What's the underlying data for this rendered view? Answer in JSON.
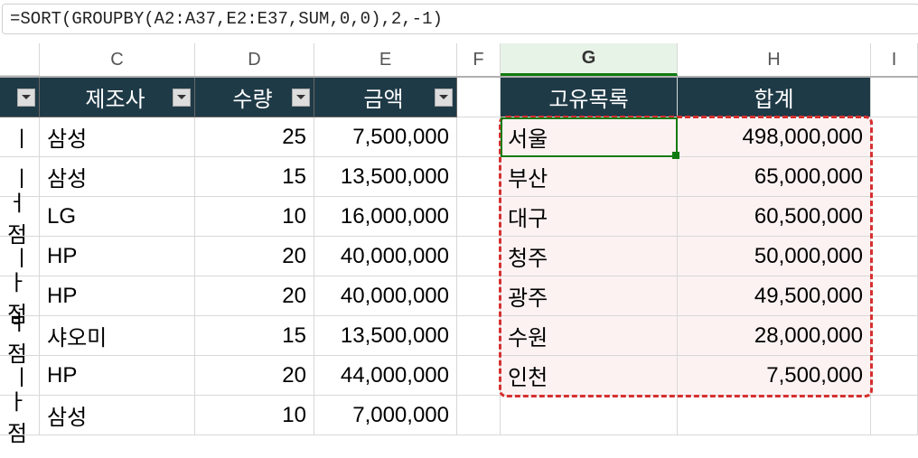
{
  "formula": "=SORT(GROUPBY(A2:A37,E2:E37,SUM,0,0),2,-1)",
  "col_headers": {
    "c": "C",
    "d": "D",
    "e": "E",
    "f": "F",
    "g": "G",
    "h": "H",
    "i": "I"
  },
  "table_headers": {
    "c": "제조사",
    "d": "수량",
    "e": "금액"
  },
  "summary_headers": {
    "g": "고유목록",
    "h": "합계"
  },
  "left_rows": [
    {
      "c": "삼성",
      "d": "25",
      "e": "7,500,000"
    },
    {
      "c": "삼성",
      "d": "15",
      "e": "13,500,000"
    },
    {
      "c": "LG",
      "d": "10",
      "e": "16,000,000"
    },
    {
      "c": "HP",
      "d": "20",
      "e": "40,000,000"
    },
    {
      "c": "HP",
      "d": "20",
      "e": "40,000,000"
    },
    {
      "c": "샤오미",
      "d": "15",
      "e": "13,500,000"
    },
    {
      "c": "HP",
      "d": "20",
      "e": "44,000,000"
    },
    {
      "c": "삼성",
      "d": "10",
      "e": "7,000,000"
    }
  ],
  "summary_rows": [
    {
      "g": "서울",
      "h": "498,000,000"
    },
    {
      "g": "부산",
      "h": "65,000,000"
    },
    {
      "g": "대구",
      "h": "60,500,000"
    },
    {
      "g": "청주",
      "h": "50,000,000"
    },
    {
      "g": "광주",
      "h": "49,500,000"
    },
    {
      "g": "수원",
      "h": "28,000,000"
    },
    {
      "g": "인천",
      "h": "7,500,000"
    }
  ]
}
